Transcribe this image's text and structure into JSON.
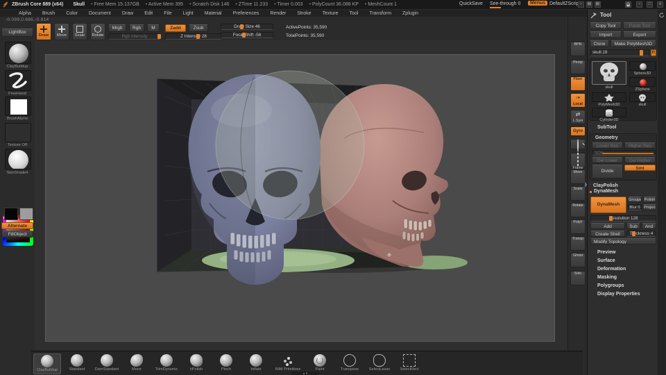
{
  "title_bar": {
    "app_title": "ZBrush Core 889 (x64)",
    "doc_name": "Skull",
    "stats": [
      "Free Mem 15.137GB",
      "Active Mem 395",
      "Scratch Disk 146",
      "ZTime 11.233",
      "Timer 0.003",
      "PolyCount 36.088 KP",
      "MeshCount 1"
    ],
    "quicksave": "QuickSave",
    "see_through": "See-through 0",
    "menus_badge": "Menus",
    "default_zscript": "DefaultZScript",
    "minimize": "−",
    "restore": "□",
    "close": "x"
  },
  "menu_bar": {
    "items": [
      "Alpha",
      "Brush",
      "Color",
      "Document",
      "Draw",
      "Edit",
      "File",
      "Light",
      "Material",
      "Preferences",
      "Render",
      "Stroke",
      "Texture",
      "Tool",
      "Transform",
      "Zplugin"
    ]
  },
  "canvas": {
    "coords": "-0.099,0.666,-0.814"
  },
  "top_shelf": {
    "lightbox": "LightBox",
    "modes": [
      {
        "label": "Draw"
      },
      {
        "label": "Move"
      },
      {
        "label": "Scale"
      },
      {
        "label": "Rotate"
      }
    ],
    "mrgb": "Mrgb",
    "rgb": "Rgb",
    "m": "M",
    "rgb_intensity": "Rgb Intensity",
    "zadd": "Zadd",
    "zsub": "Zsub",
    "z_intensity": "Z Intensity 28",
    "draw_size": "Draw Size 46",
    "focal_shift": "Focal Shift -56",
    "active_points": "ActivePoints: 35,590",
    "total_points": "TotalPoints: 35,590"
  },
  "left_shelf": {
    "brush_label": "ClayBuildup",
    "stroke_label": "FreeHand",
    "alpha_label": "BrushAlpha",
    "texture_label": "Texture  Off",
    "material_label": "SkinShade4",
    "alternate": "Alternate",
    "fill_object": "FillObject"
  },
  "right_shelf": {
    "icons": [
      {
        "label": "BPR"
      },
      {
        "label": "Persp"
      },
      {
        "label": "Floor"
      },
      {
        "label": "Local"
      },
      {
        "label": "L.Sym"
      },
      {
        "label": "Gyro"
      },
      {
        "label": "Zoom"
      },
      {
        "label": "Frame"
      },
      {
        "label": "Move"
      },
      {
        "label": "Scale"
      },
      {
        "label": "Rotate"
      },
      {
        "label": "PolyF"
      },
      {
        "label": "Transp"
      },
      {
        "label": "Ghost"
      },
      {
        "label": "Solo"
      }
    ]
  },
  "tool_palette": {
    "title": "Tool",
    "copy_tool": "Copy Tool",
    "paste_tool": "Paste Tool",
    "import": "Import",
    "export": "Export",
    "clone": "Clone",
    "make_polymesh": "Make PolyMesh3D",
    "active_tool_slider": "skull.19",
    "r_button": "R",
    "inventory": [
      {
        "label": "skull"
      },
      {
        "label": "Sphere3D"
      },
      {
        "label": "ZSphere"
      },
      {
        "label": "PolyMesh3D"
      },
      {
        "label": "skull"
      },
      {
        "label": "Cylinder3D"
      }
    ],
    "subtool_header": "SubTool",
    "geometry": {
      "header": "Geometry",
      "lower_res": "Lower Res",
      "higher_res": "Higher Res",
      "sdiv": "SDiv",
      "del_lower": "Del Lower",
      "del_higher": "Del Higher",
      "divide": "Divide",
      "smt": "Smt"
    },
    "claypolish_header": "ClayPolish",
    "dynamesh": {
      "header": "DynaMesh",
      "button": "DynaMesh",
      "groups": "Groups",
      "polish": "Polish",
      "blur": "Blur 0",
      "project": "Project",
      "resolution": "Resolution 128",
      "add": "Add",
      "sub": "Sub",
      "and": "And",
      "create_shell": "Create Shell",
      "thickness": "Thickness 4",
      "modify_topology": "Modify Topology"
    },
    "sections": [
      "Preview",
      "Surface",
      "Deformation",
      "Masking",
      "Polygroups",
      "Display Properties"
    ]
  },
  "bottom_tray": {
    "items": [
      {
        "label": "ClayBuildup"
      },
      {
        "label": "Standard"
      },
      {
        "label": "DamStandard"
      },
      {
        "label": "Move"
      },
      {
        "label": "TrimDynamic"
      },
      {
        "label": "hPolish"
      },
      {
        "label": "Pinch"
      },
      {
        "label": "Inflate"
      },
      {
        "label": "IMM Primitives"
      },
      {
        "label": "Paint"
      },
      {
        "label": "Transpose"
      },
      {
        "label": "SelectLasso"
      },
      {
        "label": "SelectRect"
      }
    ],
    "scroll_up": "▲",
    "scroll_down": "▼"
  },
  "colors": {
    "accent": "#e2812e",
    "skull_blue": "#7e82a2",
    "skull_blue_dark": "#23242e",
    "skull_red": "#ab7f79",
    "skull_red_dark": "#3c2d2b",
    "floor_green": "#94b183"
  }
}
